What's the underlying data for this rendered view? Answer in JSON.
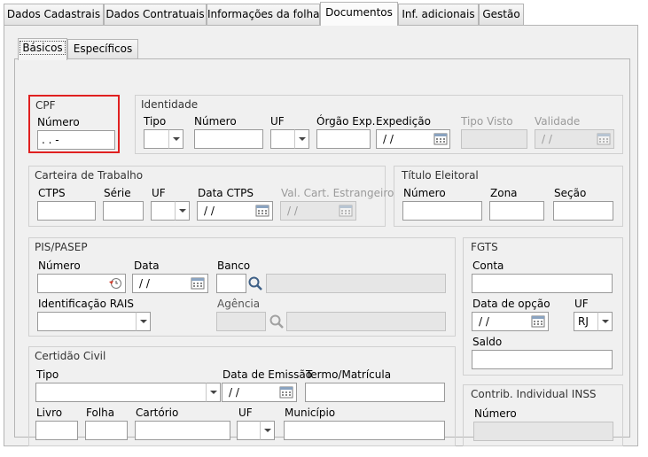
{
  "tabs": [
    {
      "label": "Dados Cadastrais"
    },
    {
      "label": "Dados Contratuais"
    },
    {
      "label": "Informações da folha"
    },
    {
      "label": "Documentos"
    },
    {
      "label": "Inf. adicionais"
    },
    {
      "label": "Gestão"
    }
  ],
  "subtabs": [
    {
      "label": "Básicos"
    },
    {
      "label": "Específicos"
    }
  ],
  "cpf": {
    "title": "CPF",
    "numero_label": "Número",
    "numero_value": " .  .  -"
  },
  "identidade": {
    "title": "Identidade",
    "tipo_label": "Tipo",
    "numero_label": "Número",
    "uf_label": "UF",
    "orgao_label": "Órgão Exp.",
    "expedicao_label": "Expedição",
    "expedicao_value": "/ /",
    "tipo_visto_label": "Tipo Visto",
    "validade_label": "Validade",
    "validade_value": "/ /"
  },
  "ctps": {
    "title": "Carteira de Trabalho",
    "ctps_label": "CTPS",
    "serie_label": "Série",
    "uf_label": "UF",
    "data_label": "Data CTPS",
    "data_value": "/ /",
    "val_label": "Val. Cart. Estrangeiro",
    "val_value": "/ /"
  },
  "titulo": {
    "title": "Título Eleitoral",
    "numero_label": "Número",
    "zona_label": "Zona",
    "secao_label": "Seção"
  },
  "pis": {
    "title": "PIS/PASEP",
    "numero_label": "Número",
    "data_label": "Data",
    "data_value": "/ /",
    "banco_label": "Banco",
    "rais_label": "Identificação RAIS",
    "agencia_label": "Agência"
  },
  "fgts": {
    "title": "FGTS",
    "conta_label": "Conta",
    "data_opcao_label": "Data de opção",
    "data_opcao_value": "/ /",
    "uf_label": "UF",
    "uf_value": "RJ",
    "saldo_label": "Saldo"
  },
  "certidao": {
    "title": "Certidão Civil",
    "tipo_label": "Tipo",
    "data_emissao_label": "Data de Emissão",
    "data_emissao_value": "/ /",
    "termo_label": "Termo/Matrícula",
    "livro_label": "Livro",
    "folha_label": "Folha",
    "cartorio_label": "Cartório",
    "uf_label": "UF",
    "municipio_label": "Município"
  },
  "inss": {
    "title": "Contrib. Individual INSS",
    "numero_label": "Número"
  },
  "colors": {
    "highlight": "#e02020",
    "panel": "#f0f0f0",
    "border": "#b5b5b5"
  }
}
